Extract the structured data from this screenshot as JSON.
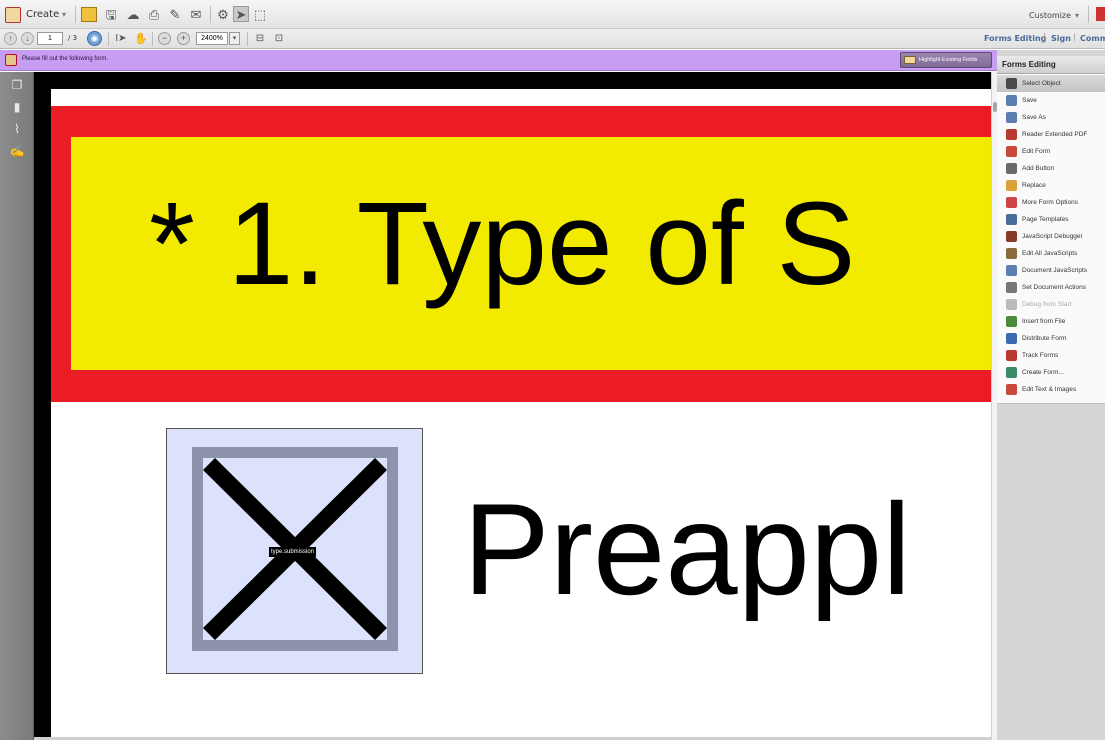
{
  "toolbar": {
    "create_label": "Create",
    "page_current": "1",
    "page_total": "/ 3",
    "zoom_value": "2400%",
    "customize_label": "Customize",
    "tabs": [
      "Forms Editing",
      "Sign",
      "Comme"
    ]
  },
  "infobar": {
    "message": "Please fill out the following form.",
    "highlight_label": "Highlight Existing Fields"
  },
  "document": {
    "heading": "* 1. Type of S",
    "checkbox_field_name": "type.submission",
    "option_label": "Preappl",
    "colors": {
      "red": "#ec1c24",
      "yellow": "#f2ea00",
      "field_fill": "#dce2fb"
    }
  },
  "pane": {
    "title": "Forms Editing",
    "items": [
      {
        "label": "Select Object",
        "icon": "arrow-cursor-icon"
      },
      {
        "label": "Save",
        "icon": "save-icon"
      },
      {
        "label": "Save As",
        "icon": "save-as-icon"
      },
      {
        "label": "Reader Extended PDF",
        "icon": "pdf-icon"
      },
      {
        "label": "Edit Form",
        "icon": "edit-form-icon"
      },
      {
        "label": "Add Button",
        "icon": "ok-button-icon"
      },
      {
        "label": "Replace",
        "icon": "replace-icon"
      },
      {
        "label": "More Form Options",
        "icon": "toolbox-icon"
      },
      {
        "label": "Page Templates",
        "icon": "page-icon"
      },
      {
        "label": "JavaScript Debugger",
        "icon": "bug-icon"
      },
      {
        "label": "Edit All JavaScripts",
        "icon": "script-icon"
      },
      {
        "label": "Document JavaScripts",
        "icon": "document-script-icon"
      },
      {
        "label": "Set Document Actions",
        "icon": "document-actions-icon"
      },
      {
        "label": "Debug from Start",
        "icon": "debug-icon"
      },
      {
        "label": "Insert from File",
        "icon": "insert-file-icon"
      },
      {
        "label": "Distribute Form",
        "icon": "distribute-icon"
      },
      {
        "label": "Track Forms",
        "icon": "track-icon"
      },
      {
        "label": "Create Form...",
        "icon": "create-form-icon"
      },
      {
        "label": "Edit Text & Images",
        "icon": "edit-text-icon"
      }
    ]
  }
}
